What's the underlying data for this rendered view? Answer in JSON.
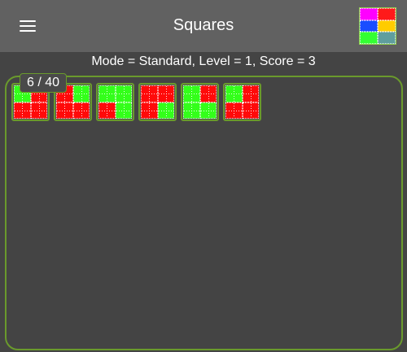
{
  "header": {
    "title": "Squares",
    "logo_colors": [
      "#ff00ff",
      "#ff1a1a",
      "#1a4dff",
      "#ffcc00",
      "#33ff33",
      "#5f9e9e"
    ]
  },
  "status": {
    "text": "Mode = Standard, Level = 1, Score = 3"
  },
  "board": {
    "counter_label": "6 / 40",
    "tiles": [
      [
        "G",
        "R",
        "R",
        "R"
      ],
      [
        "R",
        "G",
        "R",
        "R"
      ],
      [
        "G",
        "G",
        "R",
        "G"
      ],
      [
        "R",
        "R",
        "R",
        "G"
      ],
      [
        "G",
        "R",
        "G",
        "G"
      ],
      [
        "G",
        "R",
        "R",
        "R"
      ]
    ]
  },
  "colors": {
    "R": "#ff0a0a",
    "G": "#33ff1a",
    "accent": "#6a9a2c",
    "bar": "#616161",
    "background": "#444444"
  }
}
